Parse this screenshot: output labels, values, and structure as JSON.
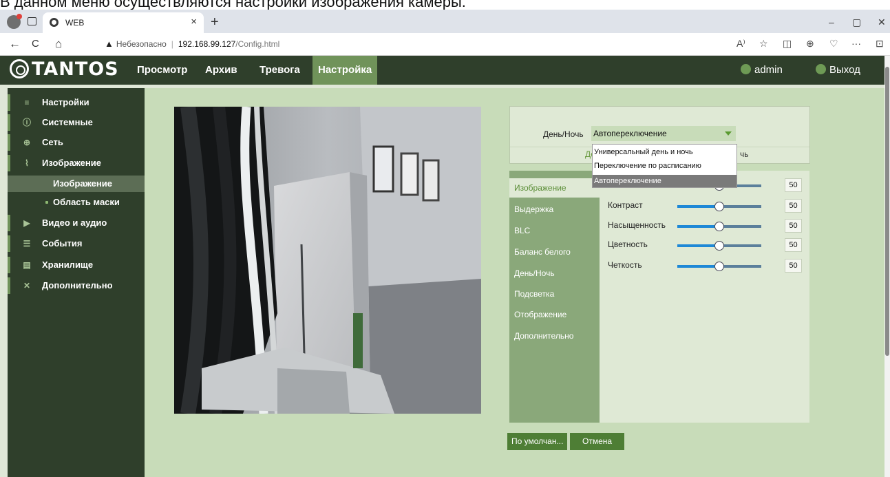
{
  "caption": "В данном меню осуществляются настройки изображения камеры.",
  "browser": {
    "tab_title": "WEB",
    "tab_close": "×",
    "new_tab": "+",
    "win_min": "–",
    "win_max": "▢",
    "win_close": "✕",
    "back": "←",
    "reload": "C",
    "home": "⌂",
    "warn_icon": "▲",
    "insecure": "Небезопасно",
    "url_host": "192.168.99.127",
    "url_path": "/Config.html",
    "tools": [
      "A⁾",
      "☆",
      "◫",
      "⊕",
      "♡",
      "···",
      "⊡"
    ]
  },
  "app": {
    "logo": "TANTOS",
    "menu": [
      "Просмотр",
      "Архив",
      "Тревога",
      "Настройка"
    ],
    "active_menu": "Настройка",
    "user": "admin",
    "logout": "Выход",
    "accent": "#70935a"
  },
  "sidebar": {
    "items": [
      {
        "icon": "≡",
        "label": "Настройки"
      },
      {
        "icon": "ⓘ",
        "label": "Системные"
      },
      {
        "icon": "⊕",
        "label": "Сеть"
      },
      {
        "icon": "⌇",
        "label": "Изображение"
      }
    ],
    "subitems": [
      {
        "label": "Изображение",
        "active": true
      },
      {
        "label": "Область маски",
        "active": false
      }
    ],
    "items2": [
      {
        "icon": "▶",
        "label": "Видео и аудио"
      },
      {
        "icon": "☰",
        "label": "События"
      },
      {
        "icon": "▤",
        "label": "Хранилище"
      },
      {
        "icon": "✕",
        "label": "Дополнительно"
      }
    ]
  },
  "daynight": {
    "label": "День/Ночь",
    "selected": "Автопереключение",
    "tab_day": "День",
    "tab_night": "чь",
    "options": [
      "Универсальный день и ночь",
      "Переключение по расписанию",
      "Автопереключение"
    ]
  },
  "tabs": [
    "Изображение",
    "Выдержка",
    "BLC",
    "Баланс белого",
    "День/Ночь",
    "Подсветка",
    "Отображение",
    "Дополнительно"
  ],
  "sliders": [
    {
      "name": "",
      "value": "50",
      "level": 0.5
    },
    {
      "name": "Контраст",
      "value": "50",
      "level": 0.5
    },
    {
      "name": "Насыщенность",
      "value": "50",
      "level": 0.5
    },
    {
      "name": "Цветность",
      "value": "50",
      "level": 0.5
    },
    {
      "name": "Четкость",
      "value": "50",
      "level": 0.5
    }
  ],
  "buttons": {
    "default": "По умолчан...",
    "cancel": "Отмена"
  }
}
